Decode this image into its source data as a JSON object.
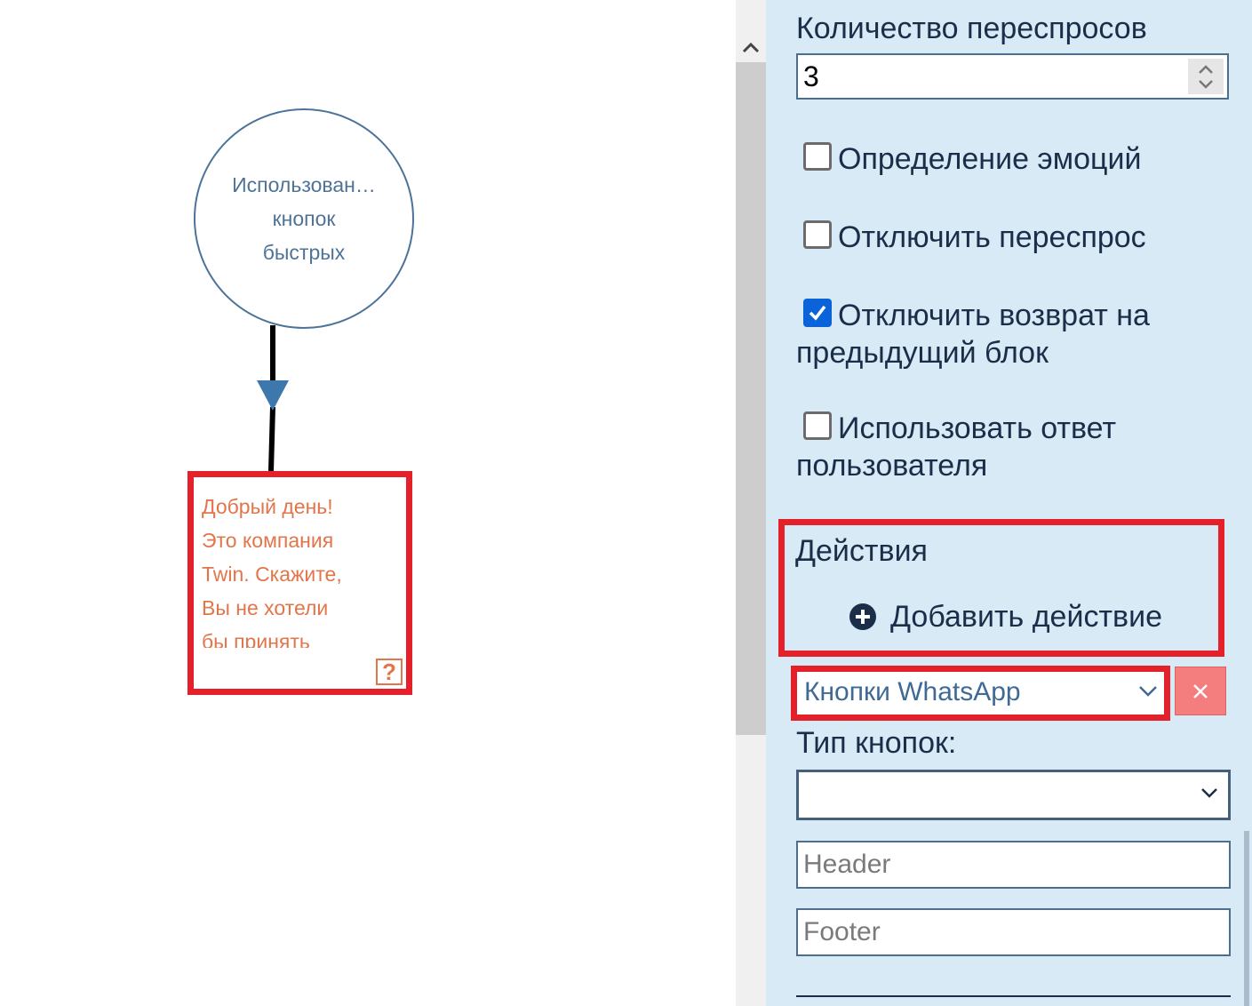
{
  "canvas": {
    "circle_node": {
      "lines": [
        "Использован…",
        "кнопок",
        "быстрых"
      ]
    },
    "message_node": {
      "lines": [
        "Добрый день!",
        "Это компания",
        "Twin. Скажите,",
        "Вы не хотели",
        "бы принять"
      ],
      "help_icon": "?"
    }
  },
  "panel": {
    "retry_count": {
      "label": "Количество переспросов",
      "value": "3"
    },
    "checkboxes": [
      {
        "label": "Определение эмоций",
        "checked": false
      },
      {
        "label": "Отключить переспрос",
        "checked": false
      },
      {
        "label": "Отключить возврат на предыдущий блок",
        "checked": true
      },
      {
        "label": "Использовать ответ пользователя",
        "checked": false
      }
    ],
    "actions": {
      "title": "Действия",
      "add_label": "Добавить действие",
      "selected_action": "Кнопки WhatsApp",
      "remove_icon": "×"
    },
    "button_type": {
      "label": "Тип кнопок:",
      "value": ""
    },
    "header_input": {
      "placeholder": "Header",
      "value": ""
    },
    "footer_input": {
      "placeholder": "Footer",
      "value": ""
    }
  },
  "colors": {
    "panel_bg": "#d7eaf5",
    "highlight": "#e4202a",
    "node_border": "#4c7399",
    "message_text": "#e2754a",
    "checkbox_checked": "#0a63d8",
    "remove_button": "#f47d7d"
  },
  "icons": {
    "scroll_up": "chevron-up-icon",
    "add_action": "plus-circle-icon",
    "dropdown": "chevron-down-icon",
    "remove": "close-icon",
    "help": "question-icon",
    "checkmark": "checkmark-icon"
  }
}
